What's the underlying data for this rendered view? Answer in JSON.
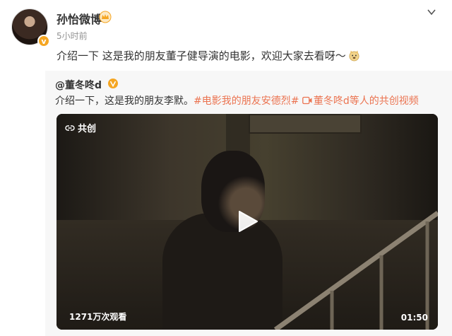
{
  "post": {
    "username": "孙怡微博",
    "timestamp": "5小时前",
    "text": "介绍一下 这是我的朋友董子健导演的电影，欢迎大家去看呀～",
    "emoji_icon": "doge-emoji-icon"
  },
  "repost": {
    "author": "@董冬咚d",
    "text_before": "介绍一下，这是我的朋友李默。",
    "hashtag": "#电影我的朋友安德烈#",
    "video_link": "董冬咚d等人的共创视频"
  },
  "video": {
    "share_label": "共创",
    "views": "1271万次观看",
    "duration": "01:50"
  },
  "colors": {
    "accent": "#eb7350",
    "vip": "#f5a623",
    "repost_bg": "#f7f7f7"
  }
}
